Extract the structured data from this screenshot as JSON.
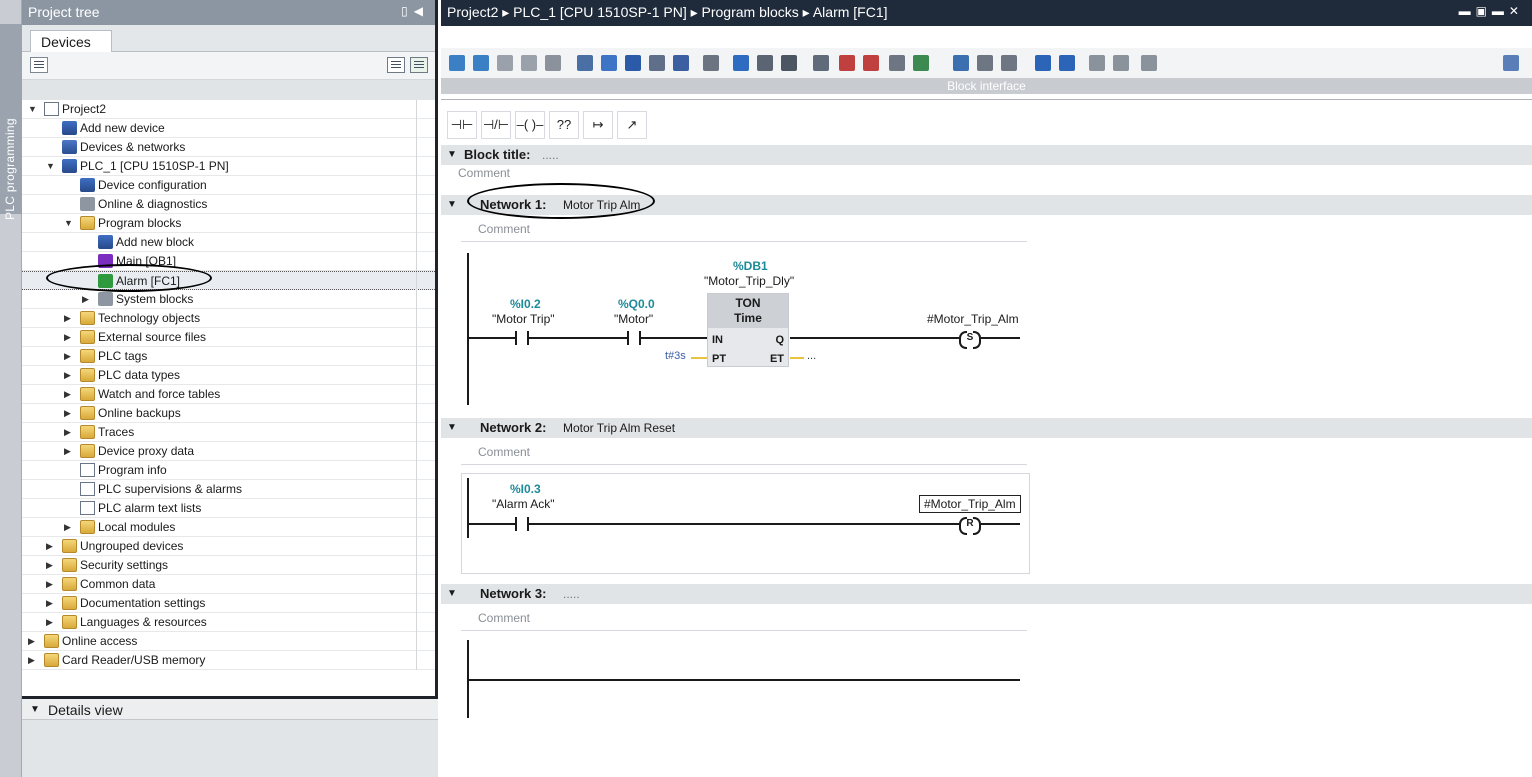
{
  "side_strip": {
    "label": "PLC programming"
  },
  "project_tree": {
    "title": "Project tree",
    "tab": "Devices",
    "items": [
      {
        "label": "Project2",
        "level": 0,
        "arrow": "▼"
      },
      {
        "label": "Add new device",
        "level": 1,
        "arrow": ""
      },
      {
        "label": "Devices & networks",
        "level": 1,
        "arrow": ""
      },
      {
        "label": "PLC_1 [CPU 1510SP-1 PN]",
        "level": 1,
        "arrow": "▼"
      },
      {
        "label": "Device configuration",
        "level": 2,
        "arrow": ""
      },
      {
        "label": "Online & diagnostics",
        "level": 2,
        "arrow": ""
      },
      {
        "label": "Program blocks",
        "level": 2,
        "arrow": "▼"
      },
      {
        "label": "Add new block",
        "level": 3,
        "arrow": ""
      },
      {
        "label": "Main [OB1]",
        "level": 3,
        "arrow": ""
      },
      {
        "label": "Alarm [FC1]",
        "level": 3,
        "arrow": ""
      },
      {
        "label": "System blocks",
        "level": 3,
        "arrow": "▶"
      },
      {
        "label": "Technology objects",
        "level": 2,
        "arrow": "▶"
      },
      {
        "label": "External source files",
        "level": 2,
        "arrow": "▶"
      },
      {
        "label": "PLC tags",
        "level": 2,
        "arrow": "▶"
      },
      {
        "label": "PLC data types",
        "level": 2,
        "arrow": "▶"
      },
      {
        "label": "Watch and force tables",
        "level": 2,
        "arrow": "▶"
      },
      {
        "label": "Online backups",
        "level": 2,
        "arrow": "▶"
      },
      {
        "label": "Traces",
        "level": 2,
        "arrow": "▶"
      },
      {
        "label": "Device proxy data",
        "level": 2,
        "arrow": "▶"
      },
      {
        "label": "Program info",
        "level": 2,
        "arrow": ""
      },
      {
        "label": "PLC supervisions & alarms",
        "level": 2,
        "arrow": ""
      },
      {
        "label": "PLC alarm text lists",
        "level": 2,
        "arrow": ""
      },
      {
        "label": "Local modules",
        "level": 2,
        "arrow": "▶"
      },
      {
        "label": "Ungrouped devices",
        "level": 1,
        "arrow": "▶"
      },
      {
        "label": "Security settings",
        "level": 1,
        "arrow": "▶"
      },
      {
        "label": "Common data",
        "level": 1,
        "arrow": "▶"
      },
      {
        "label": "Documentation settings",
        "level": 1,
        "arrow": "▶"
      },
      {
        "label": "Languages & resources",
        "level": 1,
        "arrow": "▶"
      },
      {
        "label": "Online access",
        "level": 0,
        "arrow": "▶"
      },
      {
        "label": "Card Reader/USB memory",
        "level": 0,
        "arrow": "▶"
      }
    ],
    "details_title": "Details view"
  },
  "breadcrumb": [
    "Project2",
    "PLC_1 [CPU 1510SP-1 PN]",
    "Program blocks",
    "Alarm [FC1]"
  ],
  "breadcrumb_sep": "▸",
  "editor": {
    "block_interface_label": "Block interface",
    "instructions": [
      "⊣⊢",
      "⊣/⊢",
      "–( )–",
      "??",
      "↦",
      "↗"
    ],
    "block_title_label": "Block title:",
    "block_title_value": ".....",
    "comment_placeholder": "Comment",
    "networks": [
      {
        "label": "Network 1:",
        "title": "Motor Trip Alm",
        "contacts": [
          {
            "address": "%I0.2",
            "tag": "\"Motor Trip\""
          },
          {
            "address": "%Q0.0",
            "tag": "\"Motor\""
          }
        ],
        "timer": {
          "db_address": "%DB1",
          "db_name": "\"Motor_Trip_Dly\"",
          "type": "TON",
          "subtype": "Time",
          "in": "IN",
          "pt": "PT",
          "q": "Q",
          "et": "ET",
          "pt_value": "t#3s",
          "et_value": "..."
        },
        "coil": {
          "tag": "#Motor_Trip_Alm",
          "type": "S"
        }
      },
      {
        "label": "Network 2:",
        "title": "Motor Trip Alm Reset",
        "contacts": [
          {
            "address": "%I0.3",
            "tag": "\"Alarm Ack\""
          }
        ],
        "coil": {
          "tag": "#Motor_Trip_Alm",
          "type": "R"
        }
      },
      {
        "label": "Network 3:",
        "title": "....."
      }
    ]
  }
}
